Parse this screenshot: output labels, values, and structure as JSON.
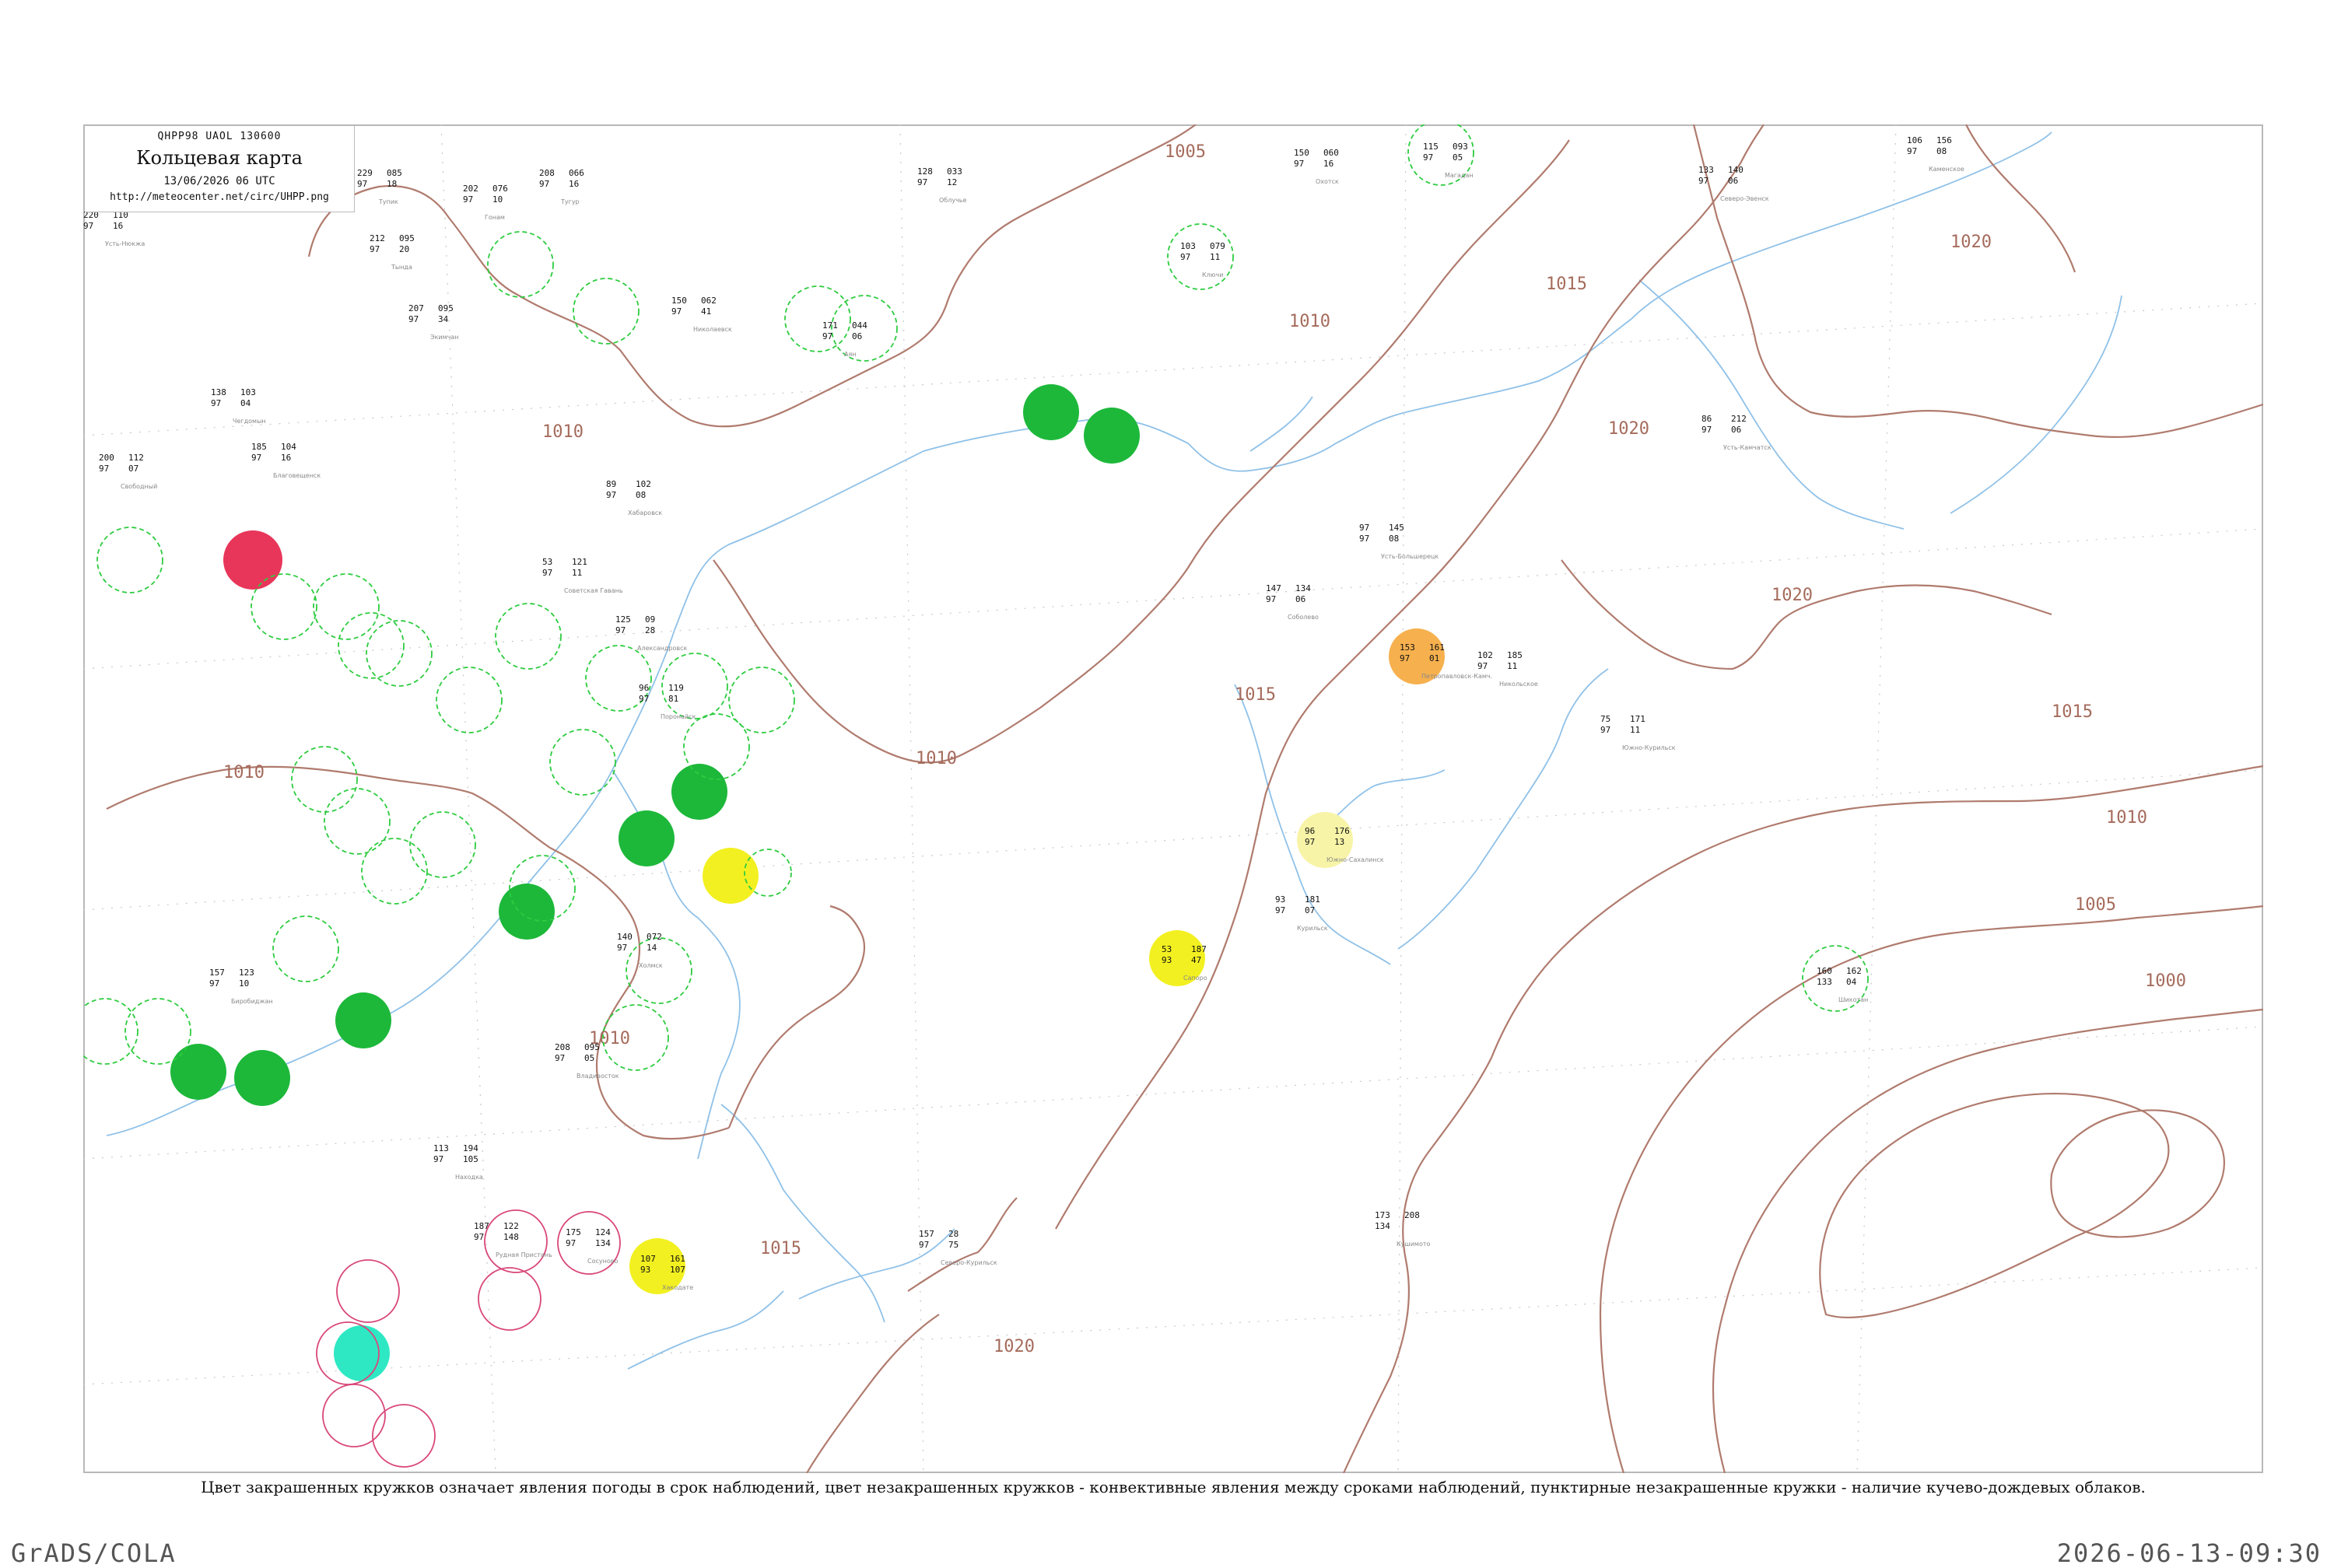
{
  "header": {
    "code": "QHPP98  UAOL  130600",
    "title": "Кольцевая карта",
    "datetime": "13/06/2026 06 UTC",
    "url": "http://meteocenter.net/circ/UHPP.png"
  },
  "caption": "Цвет закрашенных кружков означает явления погоды в срок наблюдений, цвет незакрашенных кружков - конвективные явления между сроками наблюдений, пунктирные незакрашенные кружки - наличие кучево-дождевых облаков.",
  "footer": {
    "software": "GrADS/COLA",
    "generated": "2026-06-13-09:30"
  },
  "colors": {
    "isobar": "#b07b6e",
    "coast": "#8fc1e8",
    "green_dash": "#2ecc40",
    "green_fill": "#1db83a",
    "red_fill": "#e8365a",
    "yellow_fill": "#f2f020",
    "orange_fill": "#f6b04e",
    "pale_yellow_fill": "#f7f4a8",
    "cyan_fill": "#2ee8c4",
    "pink_ring": "#d9477a"
  },
  "isobar_labels": [
    "1005",
    "1010",
    "1010",
    "1010",
    "1010",
    "1010",
    "1015",
    "1015",
    "1015",
    "1015",
    "1020",
    "1020",
    "1020",
    "1020",
    "1010",
    "1005",
    "1000"
  ],
  "stations": [
    {
      "id": "s1",
      "name": "Усть-Нюкжа",
      "vals": [
        "220",
        "110",
        "97",
        "16"
      ]
    },
    {
      "id": "s2",
      "name": "Тупик",
      "vals": [
        "229",
        "085",
        "97",
        "18"
      ]
    },
    {
      "id": "s3",
      "name": "Тында",
      "vals": [
        "212",
        "095",
        "97",
        "20"
      ]
    },
    {
      "id": "s4",
      "name": "Гонам",
      "vals": [
        "202",
        "076",
        "97",
        "10"
      ]
    },
    {
      "id": "s5",
      "name": "Тугур",
      "vals": [
        "208",
        "066",
        "97",
        "16"
      ]
    },
    {
      "id": "s6",
      "name": "Охотск",
      "vals": [
        "150",
        "060",
        "97",
        "16"
      ]
    },
    {
      "id": "s7",
      "name": "Магадан",
      "vals": [
        "115",
        "093",
        "97",
        "05"
      ]
    },
    {
      "id": "s8",
      "name": "Северо-Эвенск",
      "vals": [
        "133",
        "140",
        "97",
        "06"
      ]
    },
    {
      "id": "s9",
      "name": "Каменское",
      "vals": [
        "106",
        "156",
        "97",
        "08"
      ]
    },
    {
      "id": "s10",
      "name": "Облучье",
      "vals": [
        "128",
        "033",
        "97",
        "12"
      ]
    },
    {
      "id": "s11",
      "name": "Ключи",
      "vals": [
        "103",
        "079",
        "97",
        "11"
      ]
    },
    {
      "id": "s12",
      "name": "Аян",
      "vals": [
        "171",
        "044",
        "97",
        "06"
      ]
    },
    {
      "id": "s13",
      "name": "Николаевск",
      "vals": [
        "150",
        "062",
        "97",
        "41"
      ]
    },
    {
      "id": "s14",
      "name": "Усть-Камчатск",
      "vals": [
        "86",
        "212",
        "97",
        "06"
      ]
    },
    {
      "id": "s15",
      "name": "Соболево",
      "vals": [
        "147",
        "134",
        "97",
        "06"
      ]
    },
    {
      "id": "s16",
      "name": "Усть-Большерецк",
      "vals": [
        "97",
        "145",
        "97",
        "08"
      ]
    },
    {
      "id": "s17",
      "name": "Петропавловск-Камч.",
      "vals": [
        "153",
        "161",
        "97",
        "01"
      ]
    },
    {
      "id": "s18",
      "name": "Никольское",
      "vals": [
        "102",
        "185",
        "97",
        "11"
      ]
    },
    {
      "id": "s19",
      "name": "Южно-Курильск",
      "vals": [
        "75",
        "171",
        "97",
        "11"
      ]
    },
    {
      "id": "s20",
      "name": "Хабаровск",
      "vals": [
        "89",
        "102",
        "97",
        "08"
      ]
    },
    {
      "id": "s21",
      "name": "Благовещенск",
      "vals": [
        "185",
        "104",
        "97",
        "16"
      ]
    },
    {
      "id": "s22",
      "name": "Свободный",
      "vals": [
        "200",
        "112",
        "97",
        "07"
      ]
    },
    {
      "id": "s23",
      "name": "Советская Гавань",
      "vals": [
        "53",
        "121",
        "97",
        "11"
      ]
    },
    {
      "id": "s24",
      "name": "Александровск",
      "vals": [
        "125",
        "09",
        "97",
        "28"
      ]
    },
    {
      "id": "s25",
      "name": "Поронайск",
      "vals": [
        "96",
        "119",
        "97",
        "81"
      ]
    },
    {
      "id": "s26",
      "name": "Холмск",
      "vals": [
        "140",
        "072",
        "97",
        "14"
      ]
    },
    {
      "id": "s27",
      "name": "Южно-Сахалинск",
      "vals": [
        "96",
        "176",
        "97",
        "13"
      ]
    },
    {
      "id": "s28",
      "name": "Курильск",
      "vals": [
        "93",
        "181",
        "97",
        "07"
      ]
    },
    {
      "id": "s29",
      "name": "Северо-Курильск",
      "vals": [
        "157",
        "28",
        "97",
        "75"
      ]
    },
    {
      "id": "s30",
      "name": "Владивосток",
      "vals": [
        "208",
        "095",
        "97",
        "05"
      ]
    },
    {
      "id": "s31",
      "name": "Находка",
      "vals": [
        "113",
        "194",
        "97",
        "105"
      ]
    },
    {
      "id": "s32",
      "name": "Рудная Пристань",
      "vals": [
        "187",
        "122",
        "97",
        "148"
      ]
    },
    {
      "id": "s33",
      "name": "Сосуново",
      "vals": [
        "175",
        "124",
        "97",
        "134"
      ]
    },
    {
      "id": "s34",
      "name": "Хакодате",
      "vals": [
        "107",
        "161",
        "93",
        "107"
      ]
    },
    {
      "id": "s35",
      "name": "Кушимото",
      "vals": [
        "173",
        "208",
        "134",
        ""
      ]
    },
    {
      "id": "s36",
      "name": "Шикотан",
      "vals": [
        "160",
        "162",
        "133",
        "04"
      ]
    },
    {
      "id": "s37",
      "name": "Сапоро",
      "vals": [
        "53",
        "187",
        "93",
        "47"
      ]
    },
    {
      "id": "s38",
      "name": "Биробиджан",
      "vals": [
        "157",
        "123",
        "97",
        "10"
      ]
    },
    {
      "id": "s39",
      "name": "Чегдомын",
      "vals": [
        "138",
        "103",
        "97",
        "04"
      ]
    },
    {
      "id": "s40",
      "name": "Экимчан",
      "vals": [
        "207",
        "095",
        "97",
        "34"
      ]
    }
  ]
}
